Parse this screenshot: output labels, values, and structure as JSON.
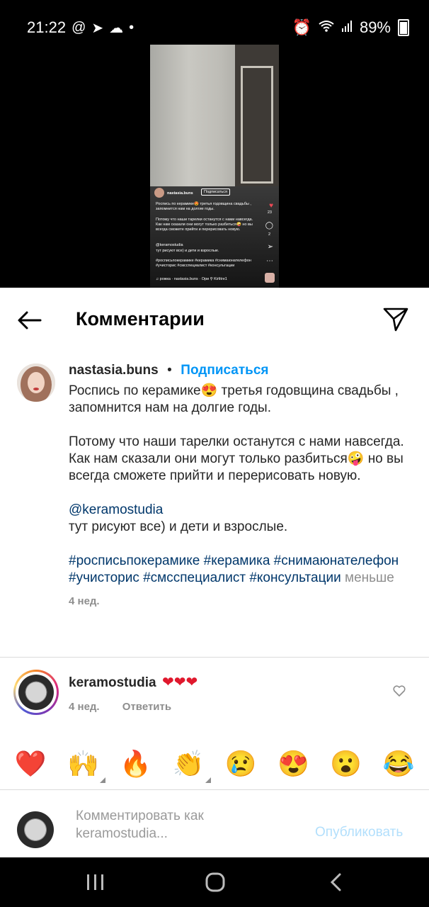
{
  "status_bar": {
    "time": "21:22",
    "left_icons": [
      "at-icon",
      "telegram-icon",
      "cloud-icon",
      "dot-icon"
    ],
    "battery": "89%",
    "right_icons": [
      "alarm-icon",
      "wifi-icon",
      "signal-icon",
      "battery-icon"
    ]
  },
  "reel_preview": {
    "username": "nastasia.buns",
    "follow": "Подписаться",
    "caption_1": "Роспись по керамике😍 третья годовщина свадьбы , запомнится нам на долгие годы.",
    "caption_2": "Потому что наши тарелки останутся с нами навсегда. Как нам сказали они могут только разбиться🤪 но вы всегда сможете прийти и перерисовать новую.",
    "mention": "@keramostudia",
    "line": "тут рисуют все) и дети и взрослые.",
    "hashtags": "#росписьпокерамике #керамика #снимаюнателефон #учисторис #смсспециалист #консультации",
    "likes": "23",
    "comments": "2",
    "audio": "♫ рожка · nastasia.buns · Ори  ⚲ Kirlitre1"
  },
  "header": {
    "title": "Комментарии"
  },
  "post": {
    "username": "nastasia.buns",
    "separator": "•",
    "follow": "Подписаться",
    "caption": "Роспись по керамике😍 третья годовщина свадьбы , запомнится нам на долгие годы.\n\nПотому что наши тарелки останутся с нами навсегда. Как нам сказали они могут только разбиться🤪 но вы всегда сможете прийти и перерисовать новую.\n\n",
    "mention": "@keramostudia",
    "after_mention": " тут рисуют все) и дети и взрослые.",
    "hashtags": "#росписьпокерамике #керамика #снимаюнателефон #учисторис #смсспециалист #консультации",
    "less": "меньше",
    "time": "4 нед."
  },
  "comment": {
    "username": "keramostudia",
    "text": "❤❤❤",
    "time": "4 нед.",
    "reply": "Ответить"
  },
  "quick_emojis": [
    "❤️",
    "🙌",
    "🔥",
    "👏",
    "😢",
    "😍",
    "😮",
    "😂"
  ],
  "composer": {
    "placeholder": "Комментировать как\nkeramostudia...",
    "publish": "Опубликовать"
  },
  "colors": {
    "link": "#00376b",
    "accent": "#0095f6",
    "publish_disabled": "#b2dffc",
    "muted": "#8e8e8e"
  }
}
